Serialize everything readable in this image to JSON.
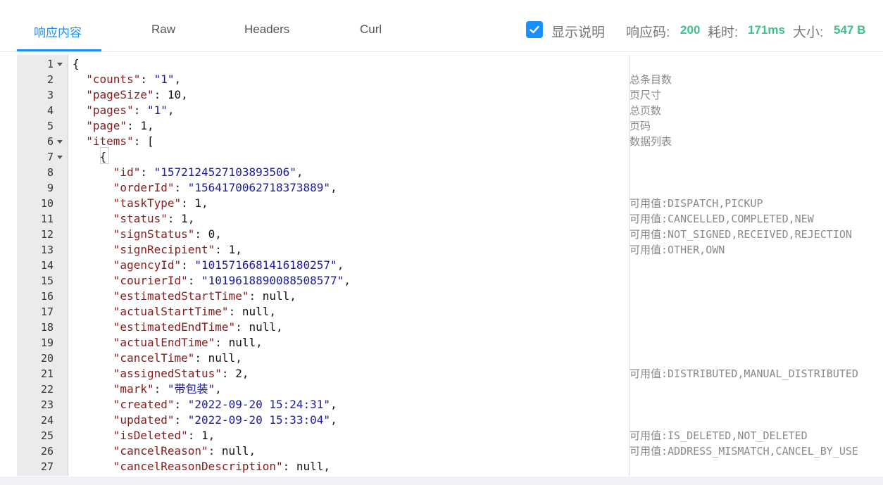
{
  "tabs": [
    {
      "label": "响应内容",
      "active": true
    },
    {
      "label": "Raw",
      "active": false
    },
    {
      "label": "Headers",
      "active": false
    },
    {
      "label": "Curl",
      "active": false
    }
  ],
  "options": {
    "show_desc_label": "显示说明",
    "show_desc_checked": true
  },
  "response": {
    "code_label": "响应码:",
    "code_value": "200",
    "time_label": "耗时:",
    "time_value": "171ms",
    "size_label": "大小:",
    "size_value": "547 B"
  },
  "colors": {
    "accent": "#1890ff",
    "success": "#3fbf8a",
    "json_key": "#8b1a1a",
    "json_string": "#1a1aa6"
  },
  "code": {
    "lines": [
      {
        "n": "1",
        "text": "{"
      },
      {
        "n": "2",
        "key": "counts",
        "value": "\"1\"",
        "vtype": "s",
        "comma": ",",
        "indent": 2
      },
      {
        "n": "3",
        "key": "pageSize",
        "value": "10",
        "vtype": "n",
        "comma": ",",
        "indent": 2
      },
      {
        "n": "4",
        "key": "pages",
        "value": "\"1\"",
        "vtype": "s",
        "comma": ",",
        "indent": 2
      },
      {
        "n": "5",
        "key": "page",
        "value": "1",
        "vtype": "n",
        "comma": ",",
        "indent": 2
      },
      {
        "n": "6",
        "key": "items",
        "value": "[",
        "vtype": "n",
        "comma": "",
        "indent": 2
      },
      {
        "n": "7",
        "text": "    {"
      },
      {
        "n": "8",
        "key": "id",
        "value": "\"1572124527103893506\"",
        "vtype": "s",
        "comma": ",",
        "indent": 6
      },
      {
        "n": "9",
        "key": "orderId",
        "value": "\"1564170062718373889\"",
        "vtype": "s",
        "comma": ",",
        "indent": 6
      },
      {
        "n": "10",
        "key": "taskType",
        "value": "1",
        "vtype": "n",
        "comma": ",",
        "indent": 6
      },
      {
        "n": "11",
        "key": "status",
        "value": "1",
        "vtype": "n",
        "comma": ",",
        "indent": 6
      },
      {
        "n": "12",
        "key": "signStatus",
        "value": "0",
        "vtype": "n",
        "comma": ",",
        "indent": 6
      },
      {
        "n": "13",
        "key": "signRecipient",
        "value": "1",
        "vtype": "n",
        "comma": ",",
        "indent": 6
      },
      {
        "n": "14",
        "key": "agencyId",
        "value": "\"1015716681416180257\"",
        "vtype": "s",
        "comma": ",",
        "indent": 6
      },
      {
        "n": "15",
        "key": "courierId",
        "value": "\"1019618890088508577\"",
        "vtype": "s",
        "comma": ",",
        "indent": 6
      },
      {
        "n": "16",
        "key": "estimatedStartTime",
        "value": "null",
        "vtype": "n",
        "comma": ",",
        "indent": 6
      },
      {
        "n": "17",
        "key": "actualStartTime",
        "value": "null",
        "vtype": "n",
        "comma": ",",
        "indent": 6
      },
      {
        "n": "18",
        "key": "estimatedEndTime",
        "value": "null",
        "vtype": "n",
        "comma": ",",
        "indent": 6
      },
      {
        "n": "19",
        "key": "actualEndTime",
        "value": "null",
        "vtype": "n",
        "comma": ",",
        "indent": 6
      },
      {
        "n": "20",
        "key": "cancelTime",
        "value": "null",
        "vtype": "n",
        "comma": ",",
        "indent": 6
      },
      {
        "n": "21",
        "key": "assignedStatus",
        "value": "2",
        "vtype": "n",
        "comma": ",",
        "indent": 6
      },
      {
        "n": "22",
        "key": "mark",
        "value": "\"带包装\"",
        "vtype": "s",
        "comma": ",",
        "indent": 6
      },
      {
        "n": "23",
        "key": "created",
        "value": "\"2022-09-20 15:24:31\"",
        "vtype": "s",
        "comma": ",",
        "indent": 6
      },
      {
        "n": "24",
        "key": "updated",
        "value": "\"2022-09-20 15:33:04\"",
        "vtype": "s",
        "comma": ",",
        "indent": 6
      },
      {
        "n": "25",
        "key": "isDeleted",
        "value": "1",
        "vtype": "n",
        "comma": ",",
        "indent": 6
      },
      {
        "n": "26",
        "key": "cancelReason",
        "value": "null",
        "vtype": "n",
        "comma": ",",
        "indent": 6
      },
      {
        "n": "27",
        "key": "cancelReasonDescription",
        "value": "null",
        "vtype": "n",
        "comma": ",",
        "indent": 6
      }
    ],
    "fold_lines": [
      1,
      6,
      7
    ],
    "notes": [
      {
        "line": 2,
        "text": "总条目数"
      },
      {
        "line": 3,
        "text": "页尺寸"
      },
      {
        "line": 4,
        "text": "总页数"
      },
      {
        "line": 5,
        "text": "页码"
      },
      {
        "line": 6,
        "text": "数据列表"
      },
      {
        "line": 10,
        "text": "可用值:DISPATCH,PICKUP"
      },
      {
        "line": 11,
        "text": "可用值:CANCELLED,COMPLETED,NEW"
      },
      {
        "line": 12,
        "text": "可用值:NOT_SIGNED,RECEIVED,REJECTION"
      },
      {
        "line": 13,
        "text": "可用值:OTHER,OWN"
      },
      {
        "line": 21,
        "text": "可用值:DISTRIBUTED,MANUAL_DISTRIBUTED"
      },
      {
        "line": 25,
        "text": "可用值:IS_DELETED,NOT_DELETED"
      },
      {
        "line": 26,
        "text": "可用值:ADDRESS_MISMATCH,CANCEL_BY_USE"
      }
    ]
  }
}
